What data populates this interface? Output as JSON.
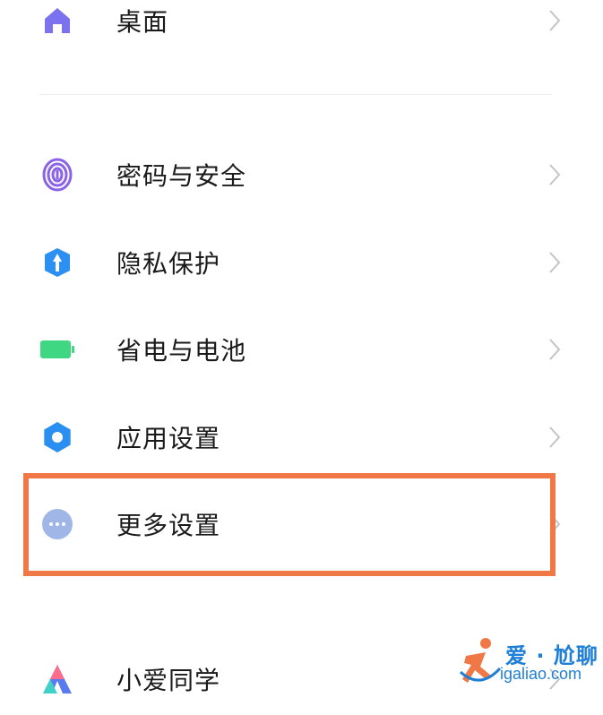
{
  "settings_items": [
    {
      "label": "桌面",
      "icon": "home-icon",
      "color": "#7b72ef"
    },
    {
      "label": "密码与安全",
      "icon": "fingerprint-icon",
      "color": "#8a63e6"
    },
    {
      "label": "隐私保护",
      "icon": "privacy-shield-icon",
      "color": "#2c8ff4"
    },
    {
      "label": "省电与电池",
      "icon": "battery-icon",
      "color": "#3fd782"
    },
    {
      "label": "应用设置",
      "icon": "gear-icon",
      "color": "#2a8ff0"
    },
    {
      "label": "更多设置",
      "icon": "more-dots-icon",
      "color": "#9fb6e6"
    },
    {
      "label": "小爱同学",
      "icon": "xiaoai-icon",
      "color": "#5a7bf0"
    }
  ],
  "highlight": {
    "target": "更多设置",
    "color": "#f07846"
  },
  "watermark": {
    "title": "爱 · 尬聊",
    "url": "igaliao.com"
  }
}
